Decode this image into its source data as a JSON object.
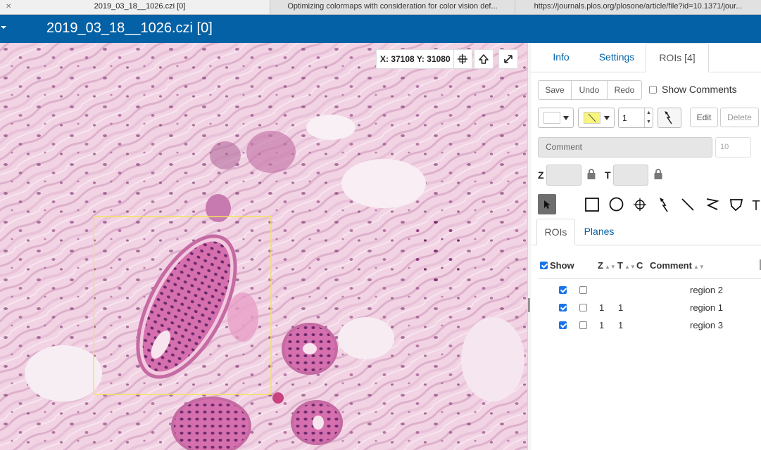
{
  "browser_tabs": [
    {
      "title": "2019_03_18__1026.czi [0]",
      "active": true
    },
    {
      "title": "Optimizing colormaps with consideration for color vision def...",
      "active": false
    },
    {
      "title": "https://journals.plos.org/plosone/article/file?id=10.1371/jour...",
      "active": false
    }
  ],
  "header": {
    "title": "2019_03_18__1026.czi [0]",
    "menu_icon": "caret-down-icon"
  },
  "viewer": {
    "coordinates": "X: 37108 Y: 31080"
  },
  "panel": {
    "tabs": [
      {
        "label": "Info"
      },
      {
        "label": "Settings"
      },
      {
        "label": "ROIs [4]",
        "active": true
      }
    ],
    "history": {
      "save": "Save",
      "undo": "Undo",
      "redo": "Redo"
    },
    "show_comments": {
      "label": "Show Comments",
      "checked": false
    },
    "shape_style": {
      "stroke_color": "#ffffff",
      "fill_color": "#f7f57a",
      "line_width": "1",
      "edit": "Edit",
      "delete": "Delete"
    },
    "comment": {
      "placeholder": "Comment",
      "font_size": "10"
    },
    "zt": {
      "z_label": "Z",
      "t_label": "T"
    },
    "tools": [
      "select-pointer-icon",
      "rectangle-icon",
      "ellipse-icon",
      "point-icon",
      "arrow-icon",
      "line-icon",
      "polyline-icon",
      "polygon-icon",
      "text-icon"
    ],
    "subtabs": [
      {
        "label": "ROIs",
        "active": true
      },
      {
        "label": "Planes"
      }
    ],
    "table": {
      "headers": {
        "show": "Show",
        "z": "Z",
        "t": "T",
        "c": "C",
        "comment": "Comment"
      },
      "rows": [
        {
          "visible": true,
          "selected": false,
          "z": "",
          "t": "",
          "comment": "region 2"
        },
        {
          "visible": true,
          "selected": false,
          "z": "1",
          "t": "1",
          "comment": "region 1"
        },
        {
          "visible": true,
          "selected": false,
          "z": "1",
          "t": "1",
          "comment": "region 3"
        }
      ]
    }
  },
  "colors": {
    "header": "#0561a5",
    "link": "#0561a5",
    "roi_outline": "#f2e35a"
  }
}
